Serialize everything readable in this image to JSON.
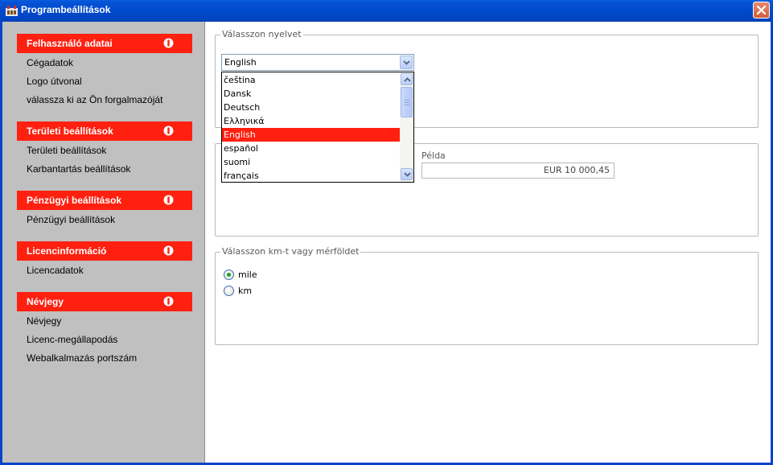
{
  "window": {
    "title": "Programbeállítások"
  },
  "sidebar": {
    "sections": [
      {
        "header": "Felhasználó adatai",
        "items": [
          "Cégadatok",
          "Logo útvonal",
          "válassza ki az Ön forgalmazóját"
        ]
      },
      {
        "header": "Területi beállítások",
        "items": [
          "Területi beállítások",
          "Karbantartás beállítások"
        ]
      },
      {
        "header": "Pénzügyi beállítások",
        "items": [
          "Pénzügyi beállítások"
        ]
      },
      {
        "header": "Licencinformáció",
        "items": [
          "Licencadatok"
        ]
      },
      {
        "header": "Névjegy",
        "items": [
          "Névjegy",
          "Licenc-megállapodás",
          "Webalkalmazás portszám"
        ]
      }
    ]
  },
  "language": {
    "legend": "Válasszon nyelvet",
    "selected": "English",
    "options": [
      "čeština",
      "Dansk",
      "Deutsch",
      "Ελληνικά",
      "English",
      "español",
      "suomi",
      "français"
    ],
    "highlighted_index": 4
  },
  "format": {
    "example_label": "Példa",
    "example_value": "EUR 10 000,45"
  },
  "units": {
    "legend": "Válasszon km-t vagy mérföldet",
    "options": [
      "mile",
      "km"
    ],
    "selected": "mile"
  },
  "colors": {
    "accent": "#ff2010",
    "titlebar": "#0049cc",
    "sidebar_bg": "#c0c0c0"
  },
  "icons": {
    "title": "app-icon",
    "close": "close-icon",
    "section_info": "info-icon"
  }
}
